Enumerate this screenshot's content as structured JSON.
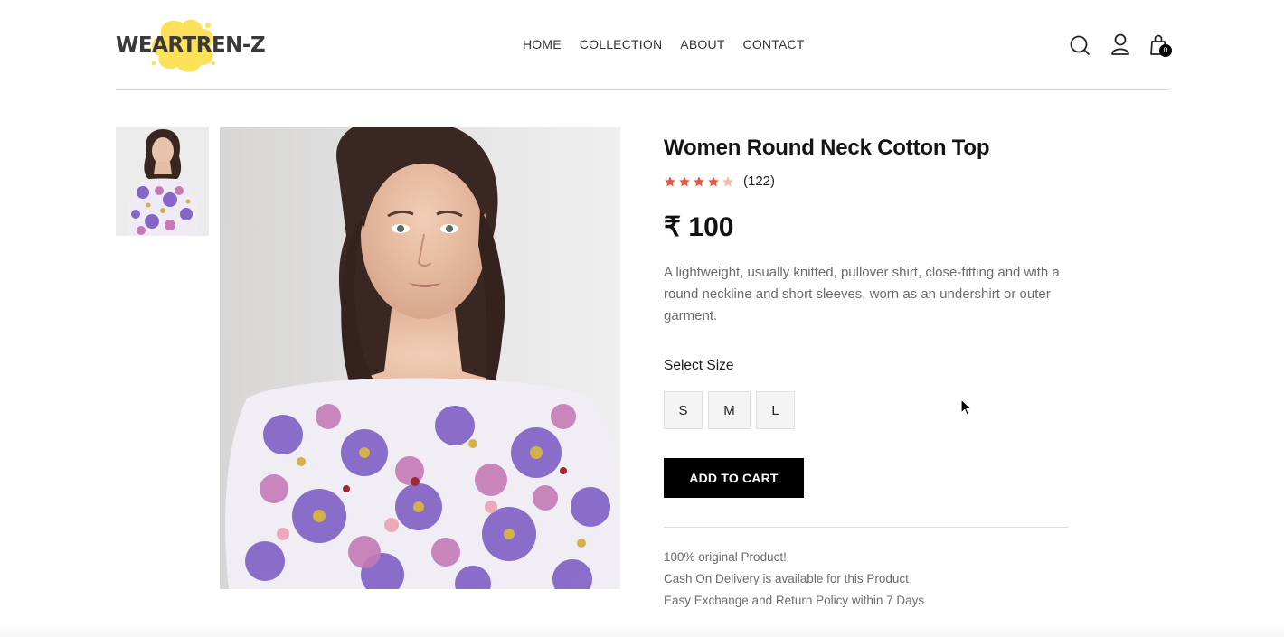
{
  "brand": {
    "logo_text": "WEARTREN-Z"
  },
  "nav": [
    {
      "label": "HOME"
    },
    {
      "label": "COLLECTION"
    },
    {
      "label": "ABOUT"
    },
    {
      "label": "CONTACT"
    }
  ],
  "header_icons": {
    "search": "search-icon",
    "profile": "user-icon",
    "cart": "shopping-bag-icon",
    "cart_count": "0"
  },
  "product": {
    "title": "Women Round Neck Cotton Top",
    "rating_stars": 4,
    "rating_max": 5,
    "rating_count": "(122)",
    "price": "₹ 100",
    "description": "A lightweight, usually knitted, pullover shirt, close-fitting and with a round neckline and short sleeves, worn as an undershirt or outer garment.",
    "size_label": "Select Size",
    "sizes": [
      "S",
      "M",
      "L"
    ],
    "add_to_cart": "ADD TO CART",
    "policies": [
      "100% original Product!",
      "Cash On Delivery is available for this Product",
      "Easy Exchange and Return Policy within 7 Days"
    ]
  },
  "colors": {
    "accent_star": "#f0533a",
    "button_bg": "#000000",
    "logo_splash": "#fde15a"
  }
}
